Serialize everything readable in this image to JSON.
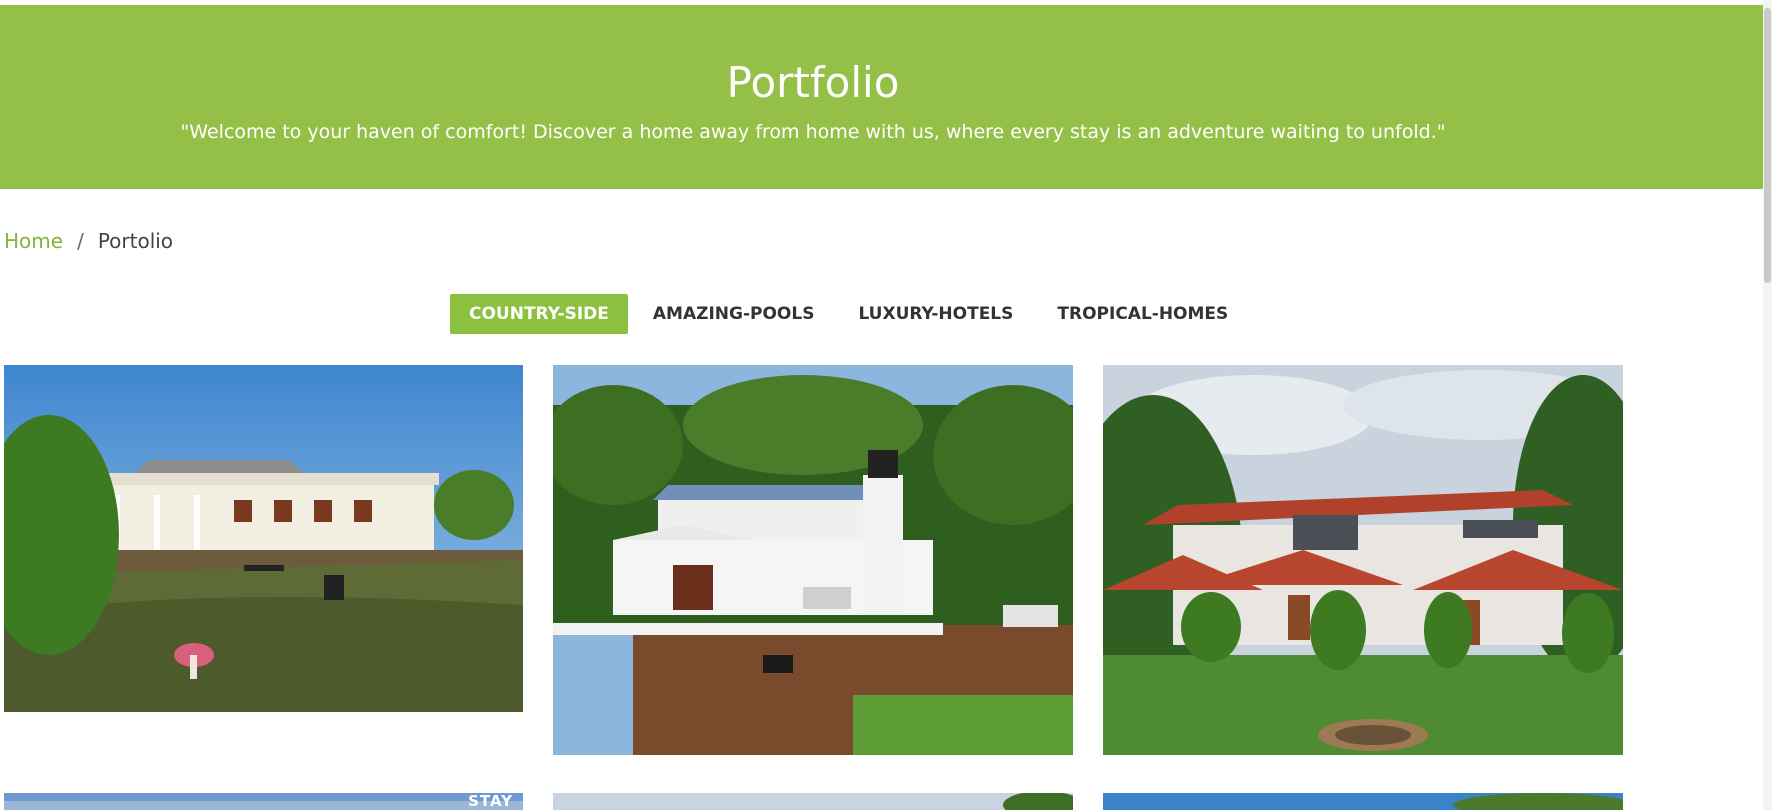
{
  "hero": {
    "title": "Portfolio",
    "subtitle": "\"Welcome to your haven of comfort! Discover a home away from home with us, where every stay is an adventure waiting to unfold.\""
  },
  "breadcrumb": {
    "home": "Home",
    "separator": "/",
    "current": "Portolio"
  },
  "filters": [
    {
      "label": "COUNTRY-SIDE",
      "active": true
    },
    {
      "label": "AMAZING-POOLS",
      "active": false
    },
    {
      "label": "LUXURY-HOTELS",
      "active": false
    },
    {
      "label": "TROPICAL-HOMES",
      "active": false
    }
  ],
  "gallery": {
    "watermark": "STAY"
  },
  "colors": {
    "brand_green": "#94c048",
    "active_filter": "#8cc03f",
    "breadcrumb_link": "#86b23d"
  }
}
